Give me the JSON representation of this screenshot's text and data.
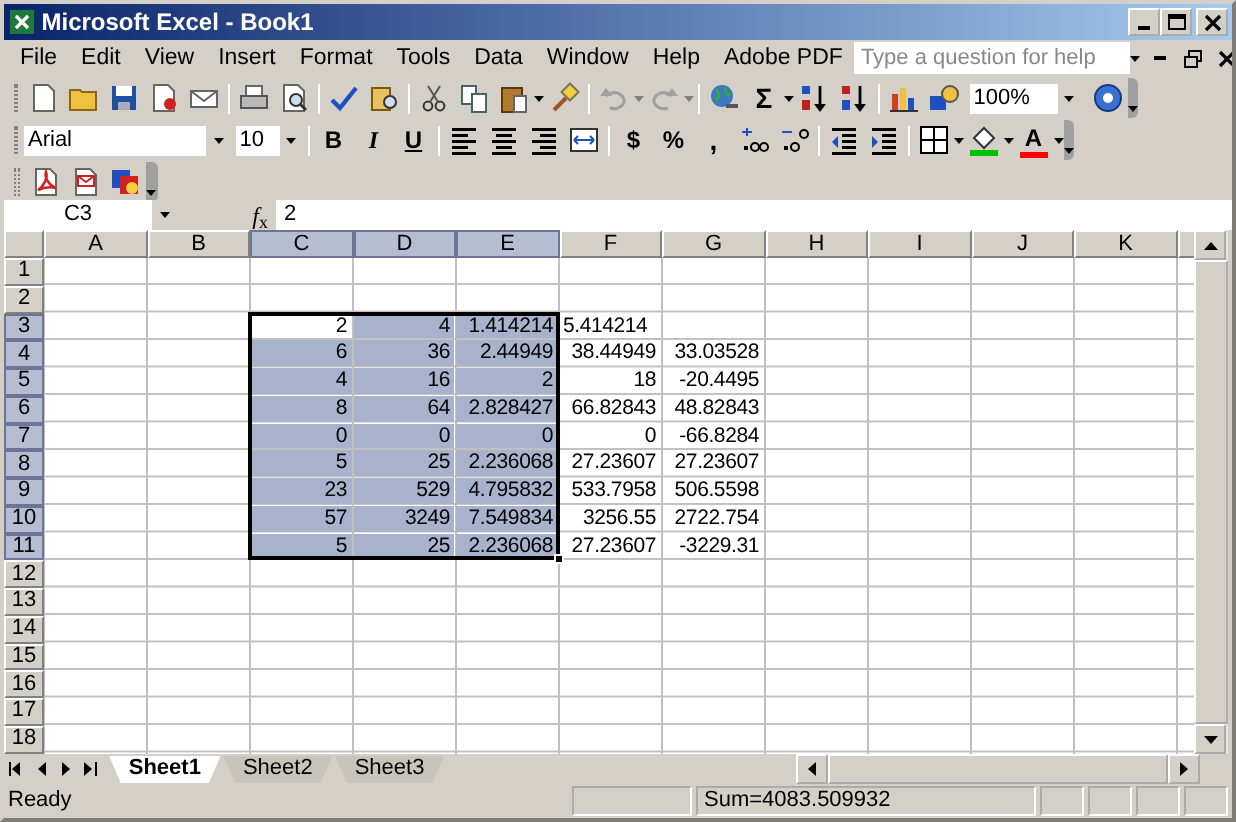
{
  "window": {
    "title": "Microsoft Excel - Book1"
  },
  "menu": {
    "items": [
      "File",
      "Edit",
      "View",
      "Insert",
      "Format",
      "Tools",
      "Data",
      "Window",
      "Help",
      "Adobe PDF"
    ],
    "help_placeholder": "Type a question for help"
  },
  "standard_toolbar": {
    "autosum": "Σ",
    "zoom": "100%"
  },
  "formatting_toolbar": {
    "font": "Arial",
    "size": "10",
    "bold": "B",
    "italic": "I",
    "underline": "U",
    "currency": "$",
    "percent": "%",
    "comma": ",",
    "font_color": "A"
  },
  "formula_bar": {
    "name_box": "C3",
    "fx": "*f*$_{x}$",
    "formula": "2"
  },
  "sheet": {
    "columns": [
      {
        "label": "A",
        "selected": false
      },
      {
        "label": "B",
        "selected": false
      },
      {
        "label": "C",
        "selected": true
      },
      {
        "label": "D",
        "selected": true
      },
      {
        "label": "E",
        "selected": true
      },
      {
        "label": "F",
        "selected": false
      },
      {
        "label": "G",
        "selected": false
      },
      {
        "label": "H",
        "selected": false
      },
      {
        "label": "I",
        "selected": false
      },
      {
        "label": "J",
        "selected": false
      },
      {
        "label": "K",
        "selected": false
      }
    ],
    "rows": [
      {
        "label": "1",
        "selected": false
      },
      {
        "label": "2",
        "selected": false
      },
      {
        "label": "3",
        "selected": true,
        "cells": [
          null,
          null,
          {
            "value": "2",
            "kind": "number",
            "selected": false
          },
          {
            "value": "4",
            "kind": "number",
            "selected": true
          },
          {
            "value": "1.414214",
            "kind": "number",
            "selected": true
          },
          {
            "value": "5.414214",
            "kind": "text",
            "selected": false
          },
          null,
          null,
          null,
          null,
          null
        ]
      },
      {
        "label": "4",
        "selected": true,
        "cells": [
          null,
          null,
          {
            "value": "6",
            "kind": "number",
            "selected": true
          },
          {
            "value": "36",
            "kind": "number",
            "selected": true
          },
          {
            "value": "2.44949",
            "kind": "number",
            "selected": true
          },
          {
            "value": "38.44949",
            "kind": "number",
            "selected": false
          },
          {
            "value": "33.03528",
            "kind": "number",
            "selected": false
          },
          null,
          null,
          null,
          null
        ]
      },
      {
        "label": "5",
        "selected": true,
        "cells": [
          null,
          null,
          {
            "value": "4",
            "kind": "number",
            "selected": true
          },
          {
            "value": "16",
            "kind": "number",
            "selected": true
          },
          {
            "value": "2",
            "kind": "number",
            "selected": true
          },
          {
            "value": "18",
            "kind": "number",
            "selected": false
          },
          {
            "value": "-20.4495",
            "kind": "number",
            "selected": false
          },
          null,
          null,
          null,
          null
        ]
      },
      {
        "label": "6",
        "selected": true,
        "cells": [
          null,
          null,
          {
            "value": "8",
            "kind": "number",
            "selected": true
          },
          {
            "value": "64",
            "kind": "number",
            "selected": true
          },
          {
            "value": "2.828427",
            "kind": "number",
            "selected": true
          },
          {
            "value": "66.82843",
            "kind": "number",
            "selected": false
          },
          {
            "value": "48.82843",
            "kind": "number",
            "selected": false
          },
          null,
          null,
          null,
          null
        ]
      },
      {
        "label": "7",
        "selected": true,
        "cells": [
          null,
          null,
          {
            "value": "0",
            "kind": "number",
            "selected": true
          },
          {
            "value": "0",
            "kind": "number",
            "selected": true
          },
          {
            "value": "0",
            "kind": "number",
            "selected": true
          },
          {
            "value": "0",
            "kind": "number",
            "selected": false
          },
          {
            "value": "-66.8284",
            "kind": "number",
            "selected": false
          },
          null,
          null,
          null,
          null
        ]
      },
      {
        "label": "8",
        "selected": true,
        "cells": [
          null,
          null,
          {
            "value": "5",
            "kind": "number",
            "selected": true
          },
          {
            "value": "25",
            "kind": "number",
            "selected": true
          },
          {
            "value": "2.236068",
            "kind": "number",
            "selected": true
          },
          {
            "value": "27.23607",
            "kind": "number",
            "selected": false
          },
          {
            "value": "27.23607",
            "kind": "number",
            "selected": false
          },
          null,
          null,
          null,
          null
        ]
      },
      {
        "label": "9",
        "selected": true,
        "cells": [
          null,
          null,
          {
            "value": "23",
            "kind": "number",
            "selected": true
          },
          {
            "value": "529",
            "kind": "number",
            "selected": true
          },
          {
            "value": "4.795832",
            "kind": "number",
            "selected": true
          },
          {
            "value": "533.7958",
            "kind": "number",
            "selected": false
          },
          {
            "value": "506.5598",
            "kind": "number",
            "selected": false
          },
          null,
          null,
          null,
          null
        ]
      },
      {
        "label": "10",
        "selected": true,
        "cells": [
          null,
          null,
          {
            "value": "57",
            "kind": "number",
            "selected": true
          },
          {
            "value": "3249",
            "kind": "number",
            "selected": true
          },
          {
            "value": "7.549834",
            "kind": "number",
            "selected": true
          },
          {
            "value": "3256.55",
            "kind": "number",
            "selected": false
          },
          {
            "value": "2722.754",
            "kind": "number",
            "selected": false
          },
          null,
          null,
          null,
          null
        ]
      },
      {
        "label": "11",
        "selected": true,
        "cells": [
          null,
          null,
          {
            "value": "5",
            "kind": "number",
            "selected": true
          },
          {
            "value": "25",
            "kind": "number",
            "selected": true
          },
          {
            "value": "2.236068",
            "kind": "number",
            "selected": true
          },
          {
            "value": "27.23607",
            "kind": "number",
            "selected": false
          },
          {
            "value": "-3229.31",
            "kind": "number",
            "selected": false
          },
          null,
          null,
          null,
          null
        ]
      },
      {
        "label": "12",
        "selected": false
      },
      {
        "label": "13",
        "selected": false
      },
      {
        "label": "14",
        "selected": false
      },
      {
        "label": "15",
        "selected": false
      },
      {
        "label": "16",
        "selected": false
      },
      {
        "label": "17",
        "selected": false
      },
      {
        "label": "18",
        "selected": false
      }
    ]
  },
  "sheet_tabs": [
    {
      "label": "Sheet1",
      "selected": true
    },
    {
      "label": "Sheet2",
      "selected": false
    },
    {
      "label": "Sheet3",
      "selected": false
    }
  ],
  "status_bar": {
    "mode": "Ready",
    "sum": "Sum=4083.509932"
  }
}
